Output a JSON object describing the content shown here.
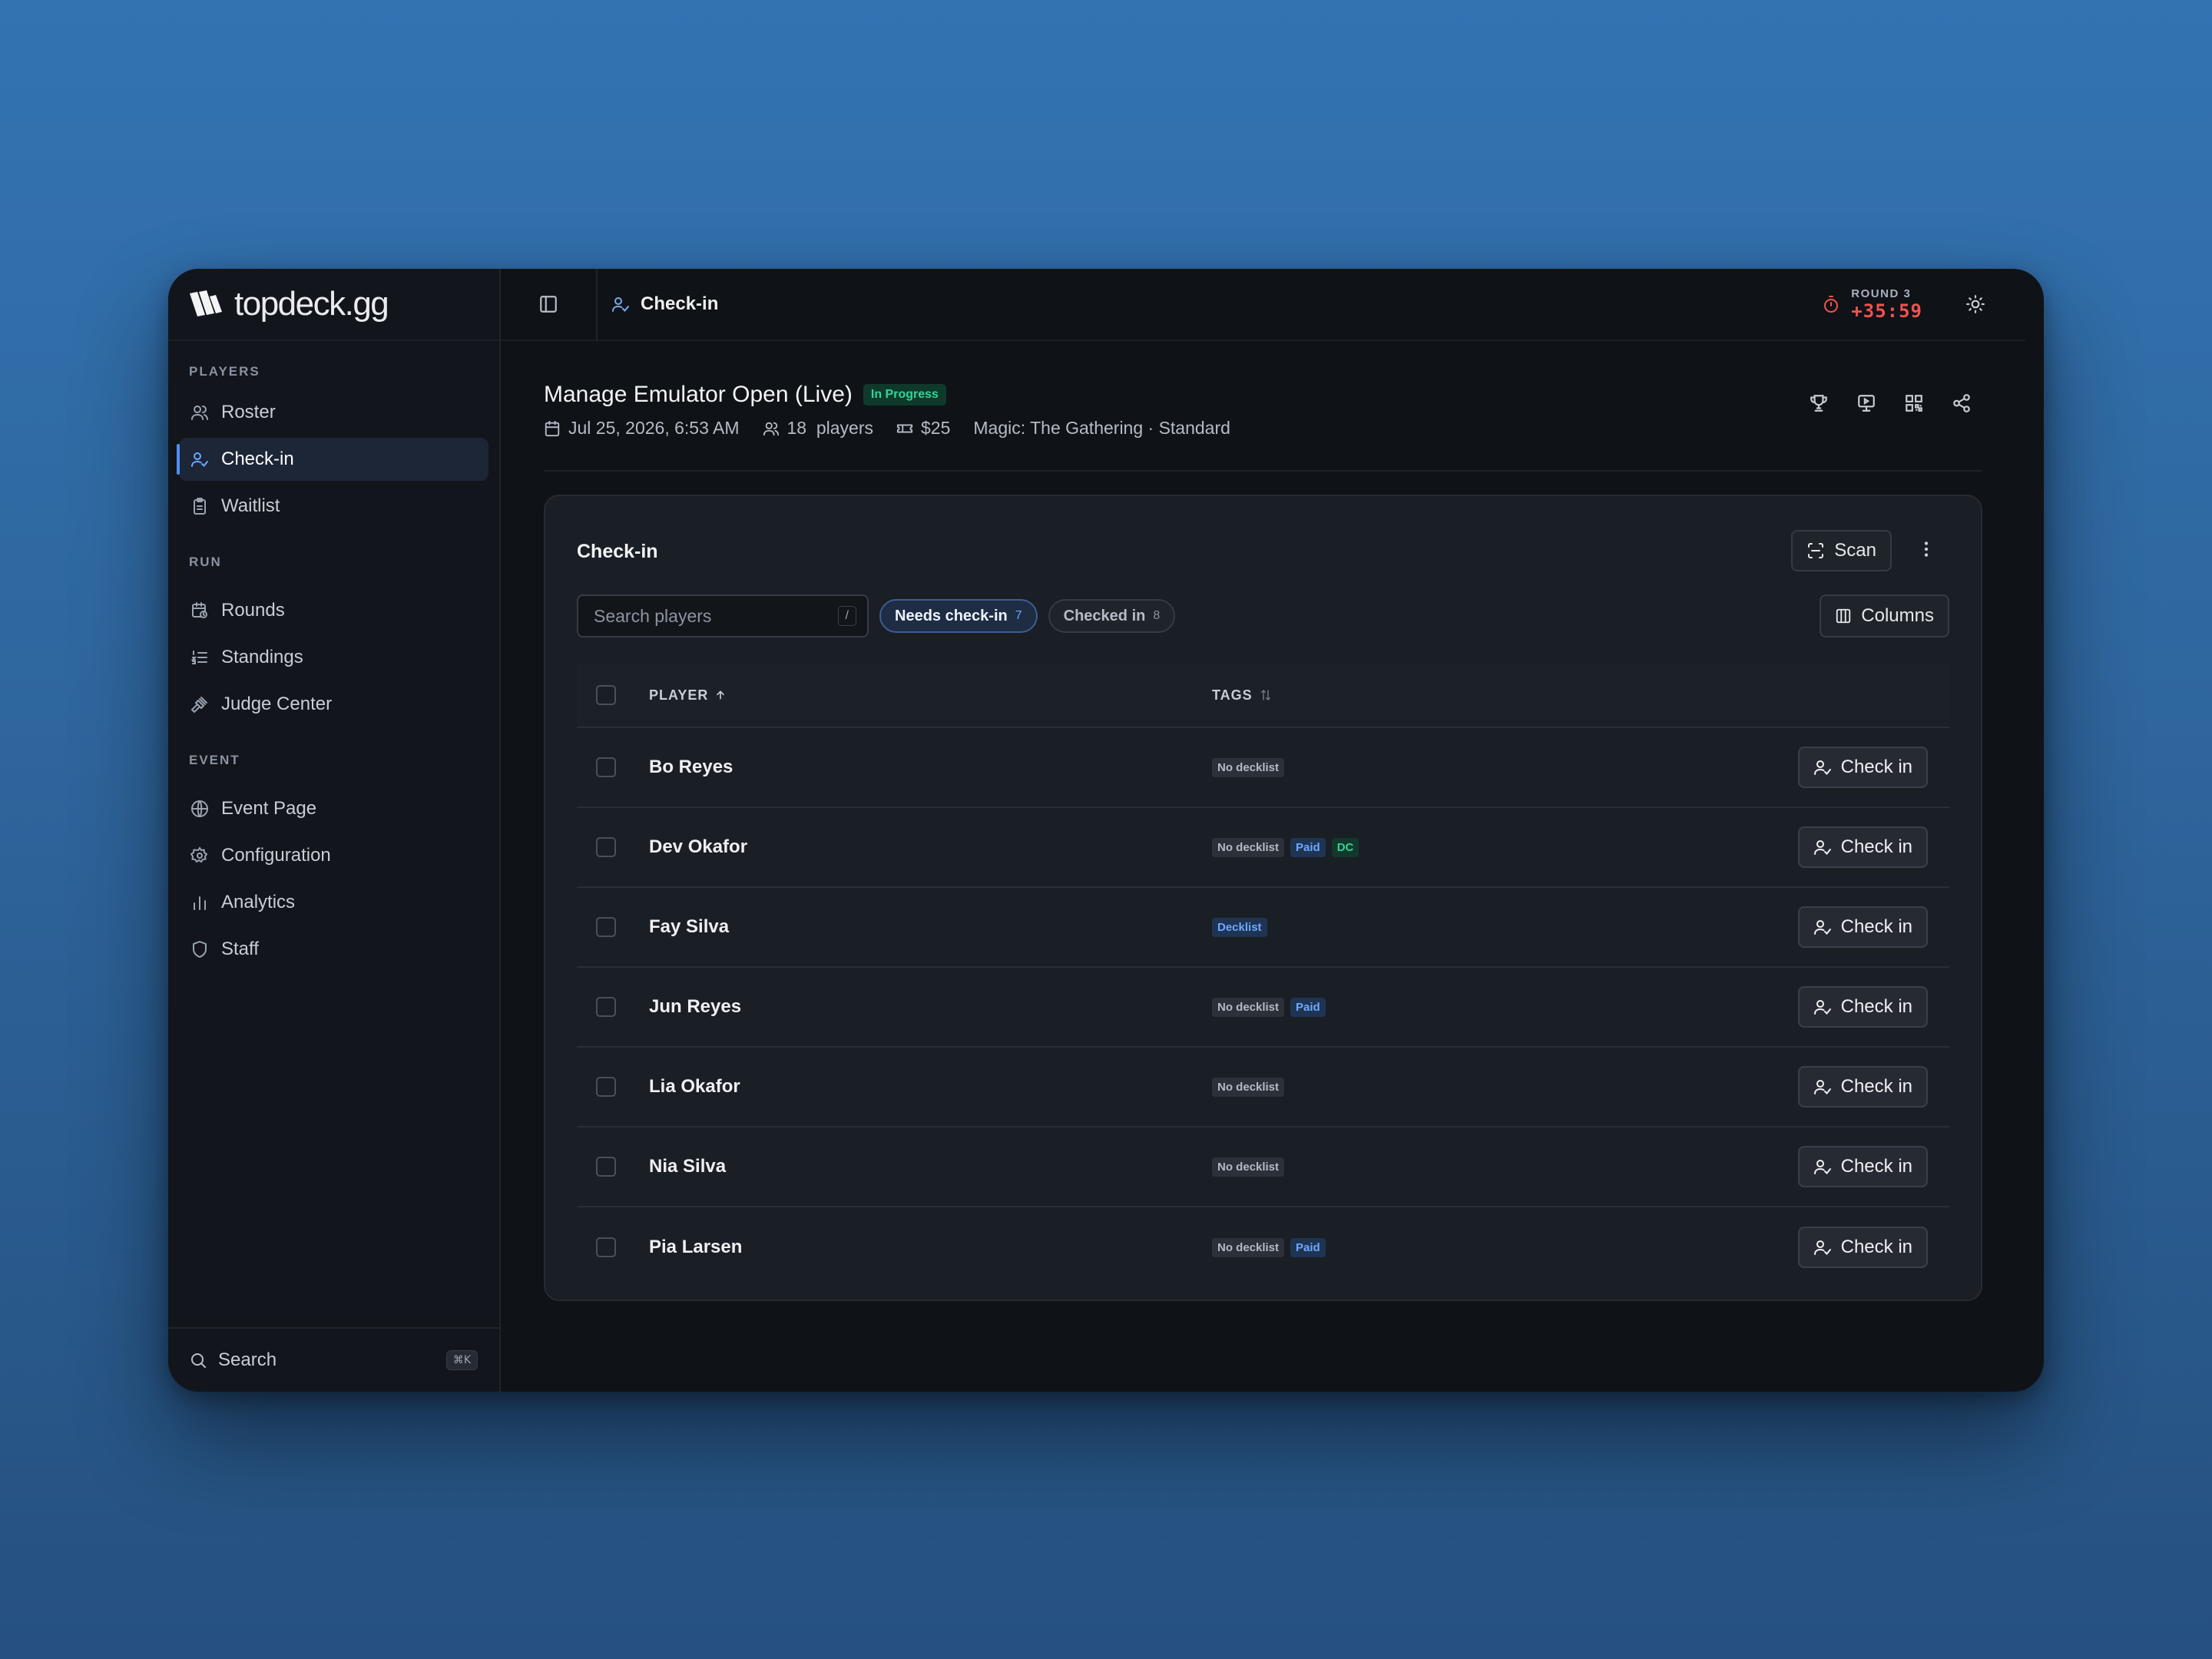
{
  "brand": {
    "name": "topdeck.gg"
  },
  "sidebar": {
    "sections": [
      {
        "label": "PLAYERS",
        "items": [
          {
            "label": "Roster",
            "icon": "users-icon"
          },
          {
            "label": "Check-in",
            "icon": "user-check-icon",
            "active": true
          },
          {
            "label": "Waitlist",
            "icon": "clipboard-icon"
          }
        ]
      },
      {
        "label": "RUN",
        "items": [
          {
            "label": "Rounds",
            "icon": "calendar-clock-icon"
          },
          {
            "label": "Standings",
            "icon": "list-ordered-icon"
          },
          {
            "label": "Judge Center",
            "icon": "gavel-icon"
          }
        ]
      },
      {
        "label": "EVENT",
        "items": [
          {
            "label": "Event Page",
            "icon": "globe-icon"
          },
          {
            "label": "Configuration",
            "icon": "gear-icon"
          },
          {
            "label": "Analytics",
            "icon": "bar-chart-icon"
          },
          {
            "label": "Staff",
            "icon": "shield-icon"
          }
        ]
      }
    ],
    "footer": {
      "search_label": "Search",
      "shortcut": "⌘K"
    }
  },
  "topbar": {
    "breadcrumb": "Check-in",
    "round_label": "ROUND 3",
    "round_time": "+35:59"
  },
  "event": {
    "title": "Manage Emulator Open (Live)",
    "status": "In Progress",
    "date": "Jul 25, 2026, 6:53 AM",
    "players": "18  players",
    "fee": "$25",
    "format": "Magic: The Gathering · Standard"
  },
  "card": {
    "title": "Check-in",
    "scan_label": "Scan",
    "search_placeholder": "Search players",
    "search_value": "",
    "search_shortcut": "/",
    "filters": [
      {
        "label": "Needs check-in",
        "count": "7",
        "active": true
      },
      {
        "label": "Checked in",
        "count": "8",
        "active": false
      }
    ],
    "columns_label": "Columns",
    "headers": {
      "player": "PLAYER",
      "tags": "TAGS"
    },
    "action_label": "Check in",
    "rows": [
      {
        "name": "Bo Reyes",
        "tags": [
          "No decklist"
        ]
      },
      {
        "name": "Dev Okafor",
        "tags": [
          "No decklist",
          "Paid",
          "DC"
        ]
      },
      {
        "name": "Fay Silva",
        "tags": [
          "Decklist"
        ]
      },
      {
        "name": "Jun Reyes",
        "tags": [
          "No decklist",
          "Paid"
        ]
      },
      {
        "name": "Lia Okafor",
        "tags": [
          "No decklist"
        ]
      },
      {
        "name": "Nia Silva",
        "tags": [
          "No decklist"
        ]
      },
      {
        "name": "Pia Larsen",
        "tags": [
          "No decklist",
          "Paid"
        ]
      }
    ]
  },
  "colors": {
    "accent": "#4f8ef7",
    "timer": "#f0534f",
    "status_green": "#34d399"
  }
}
